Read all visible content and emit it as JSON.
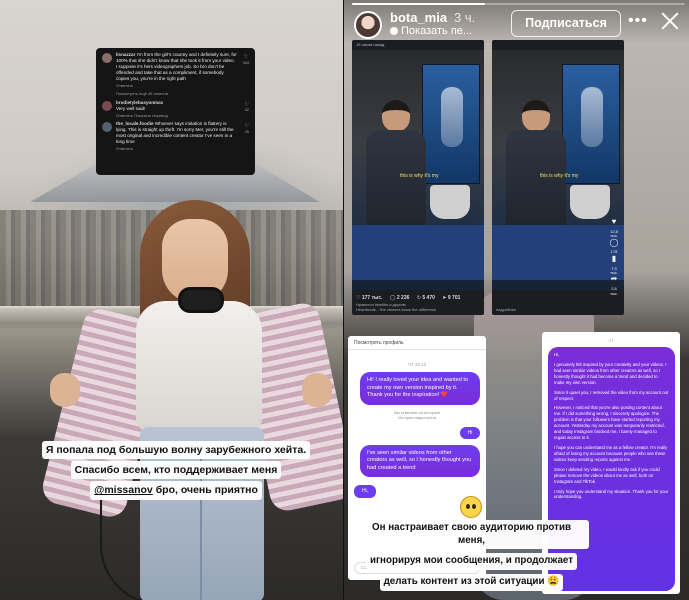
{
  "story_header": {
    "username": "bota_mia",
    "time": "3 ч.",
    "audio": "Показать пе...",
    "follow_label": "Подписаться",
    "more_icon": "more-horizontal-icon",
    "close_icon": "close-icon",
    "progress": 0.4
  },
  "comments": {
    "items": [
      {
        "user": "lisnazzar",
        "text": "I'm from the girl's country and I definitely sure, for 100% that she didn't know that she took it from your video. I suppose it's hers videographers job. So bro don't be offended and take that as a compliment, if somebody copies you, you're in the right path",
        "reply": "Ответить",
        "likes": "344",
        "more": "Посмотреть ещё 45 ответов"
      },
      {
        "user": "brodietylebasyonmax",
        "text": "Very well said!",
        "reply": "Ответить   Показать перевод",
        "likes": "42"
      },
      {
        "user": "the_locale.foodie",
        "text": "Whoever says imitation is flattery is lying. This is straight up theft. I'm sorry Mer, you're still the most original and incredible content creator I've seen in a long time",
        "reply": "Ответить",
        "likes": "25"
      }
    ]
  },
  "caption_left": {
    "line1": "Я попала под большую волну зарубежного хейта.",
    "line2": "Спасибо всем, кто поддерживает меня",
    "mention": "@missanov",
    "line3_rest": " бро, очень приятно"
  },
  "videos": [
    {
      "header": "15 часов назад",
      "overlay_text": "this is why it's my",
      "likes": "177 тыс.",
      "comments": "2 236",
      "shares": "5 470",
      "saves": "9 701",
      "footer": "Нравится tiemilks и другим",
      "footer2": "Heartbreak... the viewers know the difference"
    },
    {
      "header": "",
      "overlay_text": "this is why it's my",
      "side_likes": "12,8 тыс.",
      "side_comments": "178",
      "side_shares": "2,5 тыс.",
      "side_saves": "7,9 тыс.",
      "footer": "подробнее"
    }
  ],
  "chat_left": {
    "header": "Посмотреть профиль",
    "time": "ЧТ 22:13",
    "msg1": "Hi! I really loved your idea and wanted to create my own version inspired by it. Thank you for the inspiration! ❤️",
    "note1": "Вы ответили на историю",
    "note2": "История недоступна",
    "hi": "Hi",
    "msg2": "I've seen similar videos from other creators as well, so I honestly thought you had created a trend",
    "hi2": "Hi,",
    "input_placeholder": "Сообщение..."
  },
  "chat_right": {
    "note": "ЧТ",
    "paragraphs": [
      "Hi,",
      "I genuinely felt inspired by your creativity and your videos. I had seen similar videos from other creators as well, so I honestly thought it had become a trend and decided to make my own version.",
      "Since it upset you, I removed the video from my account out of respect.",
      "However, I noticed that you're also posting content about me. If I did something wrong, I sincerely apologize. The problem is that your followers have started reporting my account. Yesterday my account was temporarily restricted, and today Instagram blocked me. I barely managed to regain access to it.",
      "I hope you can understand me as a fellow creator. I'm really afraid of losing my account because people who see these videos keep sending reports against me.",
      "Since I deleted my video, I would kindly ask if you could please remove the videos about me as well, both on Instagram and TikTok.",
      "I truly hope you understand my situation. Thank you for your understanding."
    ]
  },
  "caption_right": {
    "line1": "Он настраивает свою аудиторию против меня,",
    "line2": "игнорируя мои сообщения, и продолжает",
    "line3": "делать контент из этой ситуации 😩"
  }
}
